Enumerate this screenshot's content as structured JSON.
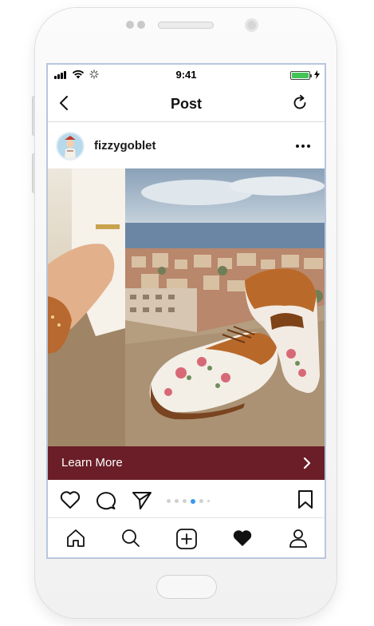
{
  "status_bar": {
    "time": "9:41"
  },
  "header": {
    "title": "Post",
    "back_icon": "chevron-left-icon",
    "refresh_icon": "refresh-icon"
  },
  "post": {
    "username": "fizzygoblet",
    "cta_label": "Learn More",
    "carousel": {
      "slide_count": 6,
      "active_index": 3
    }
  },
  "tabbar": {
    "items": [
      "home-icon",
      "search-icon",
      "new-post-icon",
      "activity-heart-icon",
      "profile-icon"
    ]
  },
  "colors": {
    "cta_background": "#6b1e27",
    "active_dot": "#3897f0",
    "battery": "#43c456",
    "screen_border": "#b8c7dd"
  }
}
